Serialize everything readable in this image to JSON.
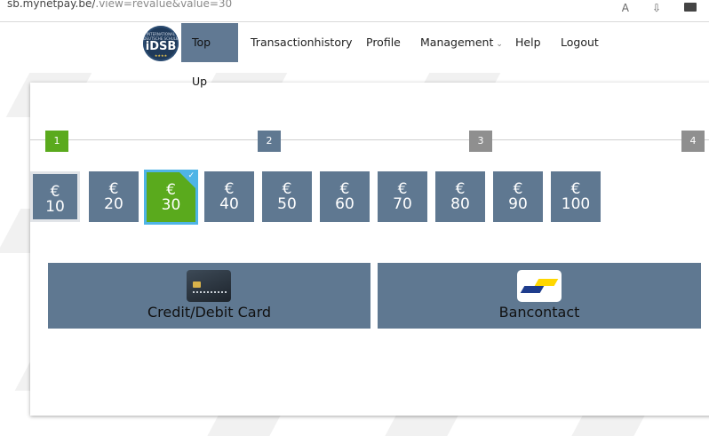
{
  "browser": {
    "url_main": "sb.mynetpay.be/",
    "url_rest": ".view=revalue&value=30"
  },
  "logo": {
    "small_text": "INTERNATIONAL DEUTSCHE SCHULE",
    "text": "iDSB",
    "stars": "★★★★"
  },
  "nav": {
    "items": [
      {
        "label": "Top Up"
      },
      {
        "label": "Transactionhistory"
      },
      {
        "label": "Profile"
      },
      {
        "label": "Management"
      },
      {
        "label": "Help"
      },
      {
        "label": "Logout"
      }
    ],
    "dropdown_glyph": "⌄"
  },
  "steps": [
    "1",
    "2",
    "3",
    "4"
  ],
  "currency": "€",
  "amounts": [
    "10",
    "20",
    "30",
    "40",
    "50",
    "60",
    "70",
    "80",
    "90",
    "100"
  ],
  "selected_amount": "30",
  "payment": {
    "card_label": "Credit/Debit Card",
    "bancontact_label": "Bancontact"
  },
  "colors": {
    "accent_blue_grey": "#5f7891",
    "active_green": "#5aaa1d",
    "selected_border": "#4fb4e6",
    "inactive_step": "#8f8f8f"
  }
}
